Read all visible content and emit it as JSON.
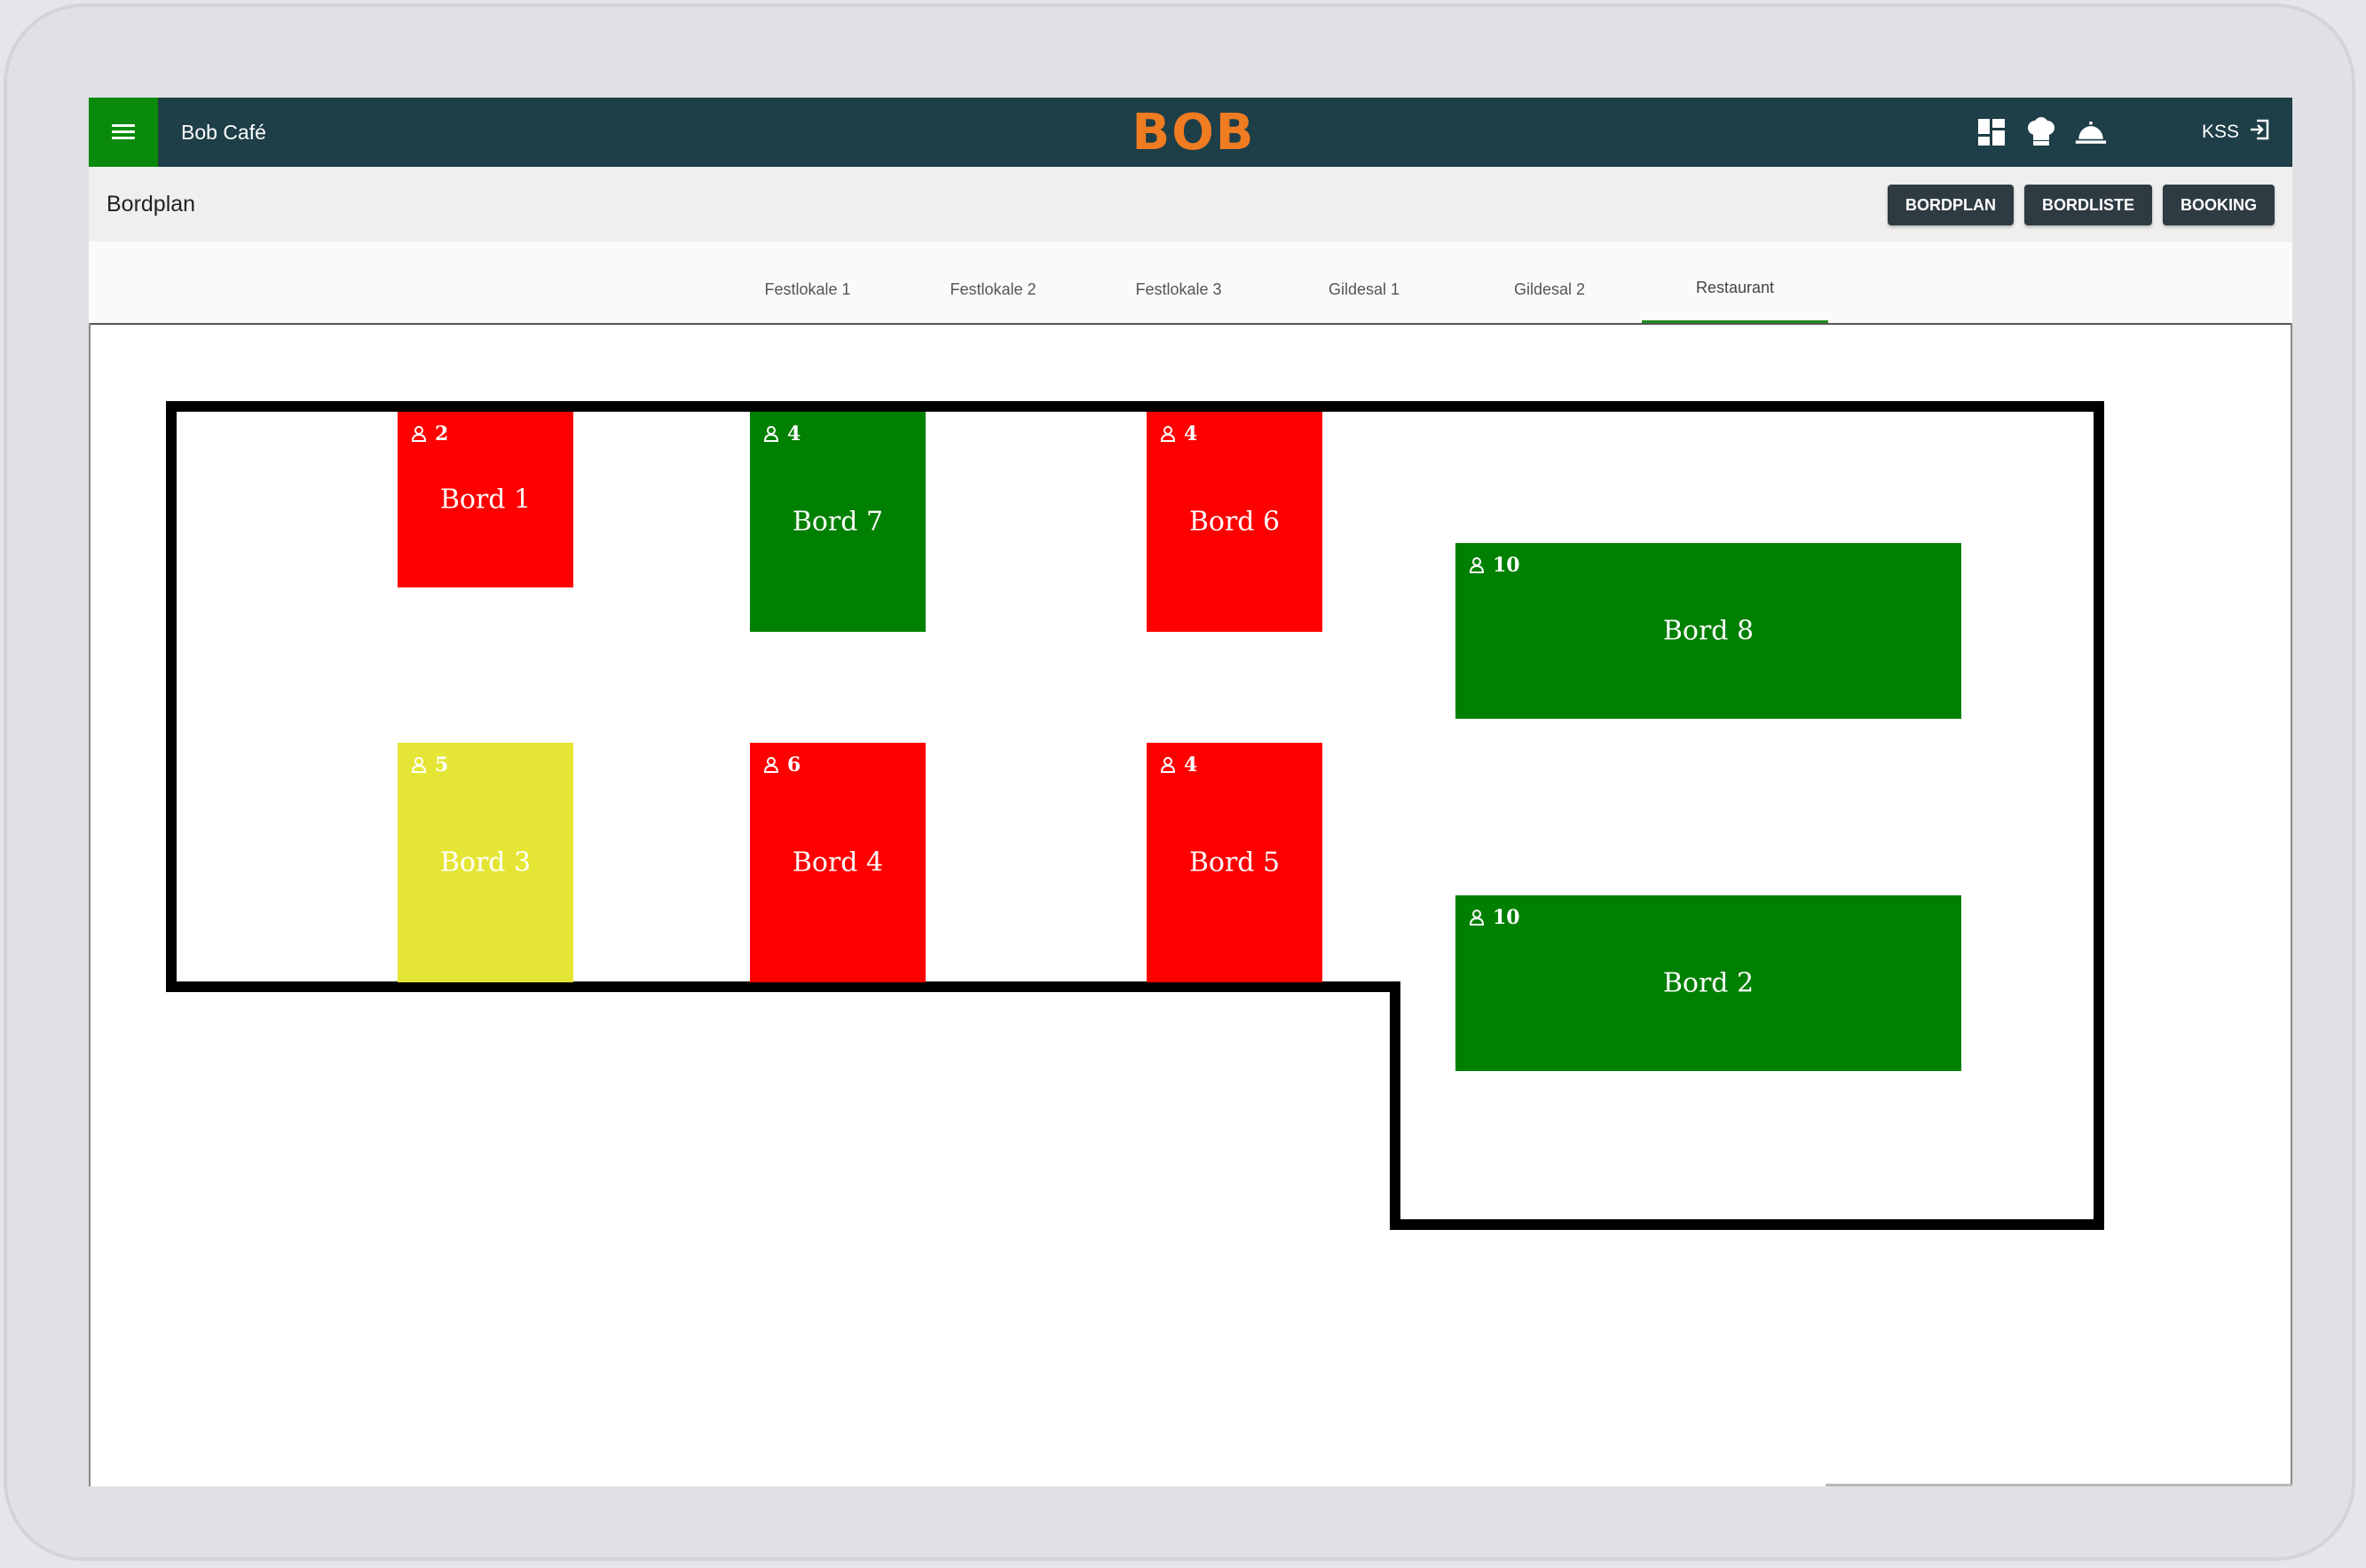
{
  "app": {
    "name": "Bob Café",
    "logo_text": "BOB",
    "user_label": "KSS"
  },
  "header": {
    "title": "Bordplan",
    "buttons": [
      "BORDPLAN",
      "BORDLISTE",
      "BOOKING"
    ]
  },
  "top_icons": [
    "dashboard-icon",
    "chef-hat-icon",
    "service-bell-icon",
    "logout-icon"
  ],
  "tabs": [
    {
      "label": "Festlokale 1",
      "active": false
    },
    {
      "label": "Festlokale 2",
      "active": false
    },
    {
      "label": "Festlokale 3",
      "active": false
    },
    {
      "label": "Gildesal 1",
      "active": false
    },
    {
      "label": "Gildesal 2",
      "active": false
    },
    {
      "label": "Restaurant",
      "active": true
    }
  ],
  "colors": {
    "topbar": "#1e3e48",
    "menu": "#0a8a0a",
    "logo": "#f07c22",
    "occupied": "#ff0000",
    "available": "#008000",
    "reserved": "#e5e535"
  },
  "tables": [
    {
      "name": "Bord 1",
      "seats": "2",
      "status": "occupied"
    },
    {
      "name": "Bord 7",
      "seats": "4",
      "status": "available"
    },
    {
      "name": "Bord 6",
      "seats": "4",
      "status": "occupied"
    },
    {
      "name": "Bord 8",
      "seats": "10",
      "status": "available"
    },
    {
      "name": "Bord 3",
      "seats": "5",
      "status": "reserved"
    },
    {
      "name": "Bord 4",
      "seats": "6",
      "status": "occupied"
    },
    {
      "name": "Bord 5",
      "seats": "4",
      "status": "occupied"
    },
    {
      "name": "Bord 2",
      "seats": "10",
      "status": "available"
    }
  ]
}
